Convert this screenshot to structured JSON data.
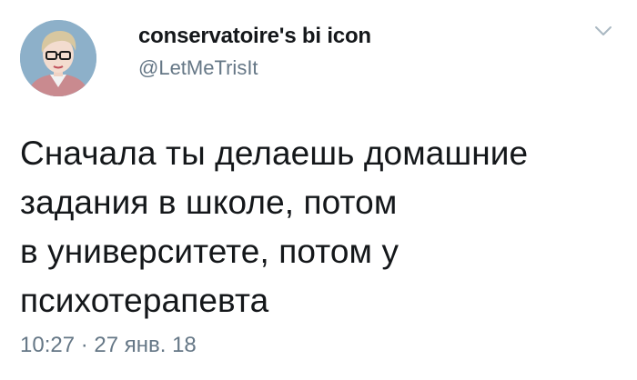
{
  "author": {
    "display_name": "conservatoire's bi icon",
    "handle": "@LetMeTrisIt"
  },
  "tweet": {
    "text_lines": [
      "Сначала ты делаешь домашние",
      "задания в школе, потом",
      "в университете, потом у",
      "психотерапевта"
    ],
    "timestamp": "10:27 · 27 янв. 18"
  },
  "icons": {
    "avatar": "avatar-profile-picture",
    "menu": "chevron-down-icon"
  },
  "colors": {
    "primary_text": "#14171a",
    "secondary_text": "#657786",
    "background": "#ffffff"
  }
}
